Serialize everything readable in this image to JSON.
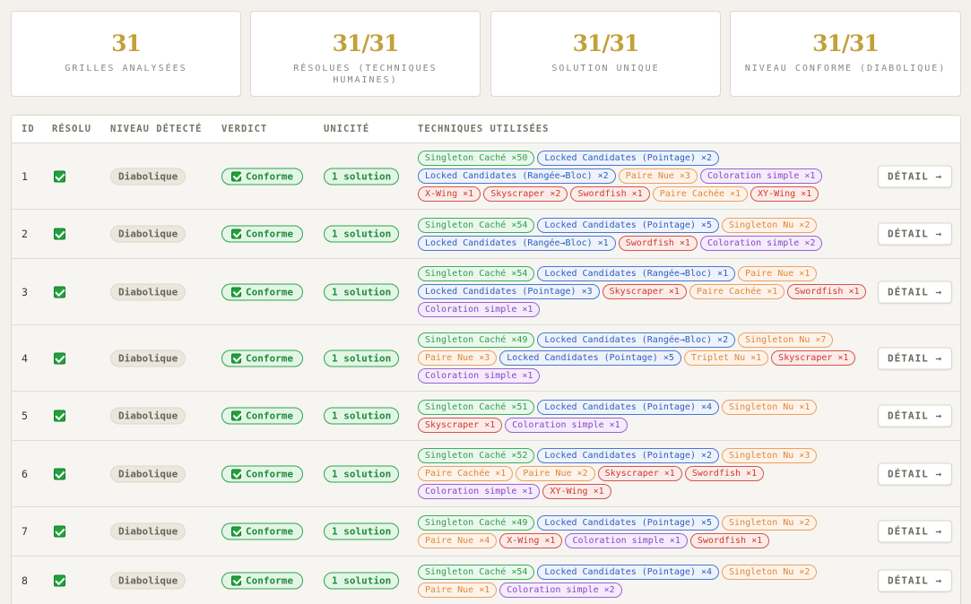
{
  "stats": [
    {
      "value": "31",
      "label": "GRILLES ANALYSÉES"
    },
    {
      "value": "31/31",
      "label": "RÉSOLUES (TECHNIQUES HUMAINES)"
    },
    {
      "value": "31/31",
      "label": "SOLUTION UNIQUE"
    },
    {
      "value": "31/31",
      "label": "NIVEAU CONFORME (DIABOLIQUE)"
    }
  ],
  "table": {
    "headers": {
      "id": "ID",
      "solved": "RÉSOLU",
      "level": "NIVEAU DÉTECTÉ",
      "verdict": "VERDICT",
      "unicity": "UNICITÉ",
      "techniques": "TECHNIQUES UTILISÉES"
    },
    "colors": {
      "green": "#2e9e4f",
      "blue": "#2d5fbf",
      "orange": "#e0873a",
      "red": "#cf3a2d",
      "purple": "#8a46c9",
      "gold": "#c2a13a"
    },
    "rows": [
      {
        "id": "1",
        "level": "Diabolique",
        "verdict": "Conforme",
        "unicity": "1 solution",
        "detail": "DÉTAIL →",
        "techniques": [
          {
            "label": "Singleton Caché ×50",
            "color": "green"
          },
          {
            "label": "Locked Candidates (Pointage) ×2",
            "color": "blue"
          },
          {
            "label": "Locked Candidates (Rangée→Bloc) ×2",
            "color": "blue"
          },
          {
            "label": "Paire Nue ×3",
            "color": "orange"
          },
          {
            "label": "Coloration simple ×1",
            "color": "purple"
          },
          {
            "label": "X-Wing ×1",
            "color": "red"
          },
          {
            "label": "Skyscraper ×2",
            "color": "red"
          },
          {
            "label": "Swordfish ×1",
            "color": "red"
          },
          {
            "label": "Paire Cachée ×1",
            "color": "orange"
          },
          {
            "label": "XY-Wing ×1",
            "color": "red"
          }
        ]
      },
      {
        "id": "2",
        "level": "Diabolique",
        "verdict": "Conforme",
        "unicity": "1 solution",
        "detail": "DÉTAIL →",
        "techniques": [
          {
            "label": "Singleton Caché ×54",
            "color": "green"
          },
          {
            "label": "Locked Candidates (Pointage) ×5",
            "color": "blue"
          },
          {
            "label": "Singleton Nu ×2",
            "color": "orange"
          },
          {
            "label": "Locked Candidates (Rangée→Bloc) ×1",
            "color": "blue"
          },
          {
            "label": "Swordfish ×1",
            "color": "red"
          },
          {
            "label": "Coloration simple ×2",
            "color": "purple"
          }
        ]
      },
      {
        "id": "3",
        "level": "Diabolique",
        "verdict": "Conforme",
        "unicity": "1 solution",
        "detail": "DÉTAIL →",
        "techniques": [
          {
            "label": "Singleton Caché ×54",
            "color": "green"
          },
          {
            "label": "Locked Candidates (Rangée→Bloc) ×1",
            "color": "blue"
          },
          {
            "label": "Paire Nue ×1",
            "color": "orange"
          },
          {
            "label": "Locked Candidates (Pointage) ×3",
            "color": "blue"
          },
          {
            "label": "Skyscraper ×1",
            "color": "red"
          },
          {
            "label": "Paire Cachée ×1",
            "color": "orange"
          },
          {
            "label": "Swordfish ×1",
            "color": "red"
          },
          {
            "label": "Coloration simple ×1",
            "color": "purple"
          }
        ]
      },
      {
        "id": "4",
        "level": "Diabolique",
        "verdict": "Conforme",
        "unicity": "1 solution",
        "detail": "DÉTAIL →",
        "techniques": [
          {
            "label": "Singleton Caché ×49",
            "color": "green"
          },
          {
            "label": "Locked Candidates (Rangée→Bloc) ×2",
            "color": "blue"
          },
          {
            "label": "Singleton Nu ×7",
            "color": "orange"
          },
          {
            "label": "Paire Nue ×3",
            "color": "orange"
          },
          {
            "label": "Locked Candidates (Pointage) ×5",
            "color": "blue"
          },
          {
            "label": "Triplet Nu ×1",
            "color": "orange"
          },
          {
            "label": "Skyscraper ×1",
            "color": "red"
          },
          {
            "label": "Coloration simple ×1",
            "color": "purple"
          }
        ]
      },
      {
        "id": "5",
        "level": "Diabolique",
        "verdict": "Conforme",
        "unicity": "1 solution",
        "detail": "DÉTAIL →",
        "techniques": [
          {
            "label": "Singleton Caché ×51",
            "color": "green"
          },
          {
            "label": "Locked Candidates (Pointage) ×4",
            "color": "blue"
          },
          {
            "label": "Singleton Nu ×1",
            "color": "orange"
          },
          {
            "label": "Skyscraper ×1",
            "color": "red"
          },
          {
            "label": "Coloration simple ×1",
            "color": "purple"
          }
        ]
      },
      {
        "id": "6",
        "level": "Diabolique",
        "verdict": "Conforme",
        "unicity": "1 solution",
        "detail": "DÉTAIL →",
        "techniques": [
          {
            "label": "Singleton Caché ×52",
            "color": "green"
          },
          {
            "label": "Locked Candidates (Pointage) ×2",
            "color": "blue"
          },
          {
            "label": "Singleton Nu ×3",
            "color": "orange"
          },
          {
            "label": "Paire Cachée ×1",
            "color": "orange"
          },
          {
            "label": "Paire Nue ×2",
            "color": "orange"
          },
          {
            "label": "Skyscraper ×1",
            "color": "red"
          },
          {
            "label": "Swordfish ×1",
            "color": "red"
          },
          {
            "label": "Coloration simple ×1",
            "color": "purple"
          },
          {
            "label": "XY-Wing ×1",
            "color": "red"
          }
        ]
      },
      {
        "id": "7",
        "level": "Diabolique",
        "verdict": "Conforme",
        "unicity": "1 solution",
        "detail": "DÉTAIL →",
        "techniques": [
          {
            "label": "Singleton Caché ×49",
            "color": "green"
          },
          {
            "label": "Locked Candidates (Pointage) ×5",
            "color": "blue"
          },
          {
            "label": "Singleton Nu ×2",
            "color": "orange"
          },
          {
            "label": "Paire Nue ×4",
            "color": "orange"
          },
          {
            "label": "X-Wing ×1",
            "color": "red"
          },
          {
            "label": "Coloration simple ×1",
            "color": "purple"
          },
          {
            "label": "Swordfish ×1",
            "color": "red"
          }
        ]
      },
      {
        "id": "8",
        "level": "Diabolique",
        "verdict": "Conforme",
        "unicity": "1 solution",
        "detail": "DÉTAIL →",
        "techniques": [
          {
            "label": "Singleton Caché ×54",
            "color": "green"
          },
          {
            "label": "Locked Candidates (Pointage) ×4",
            "color": "blue"
          },
          {
            "label": "Singleton Nu ×2",
            "color": "orange"
          },
          {
            "label": "Paire Nue ×1",
            "color": "orange"
          },
          {
            "label": "Coloration simple ×2",
            "color": "purple"
          }
        ]
      }
    ]
  }
}
